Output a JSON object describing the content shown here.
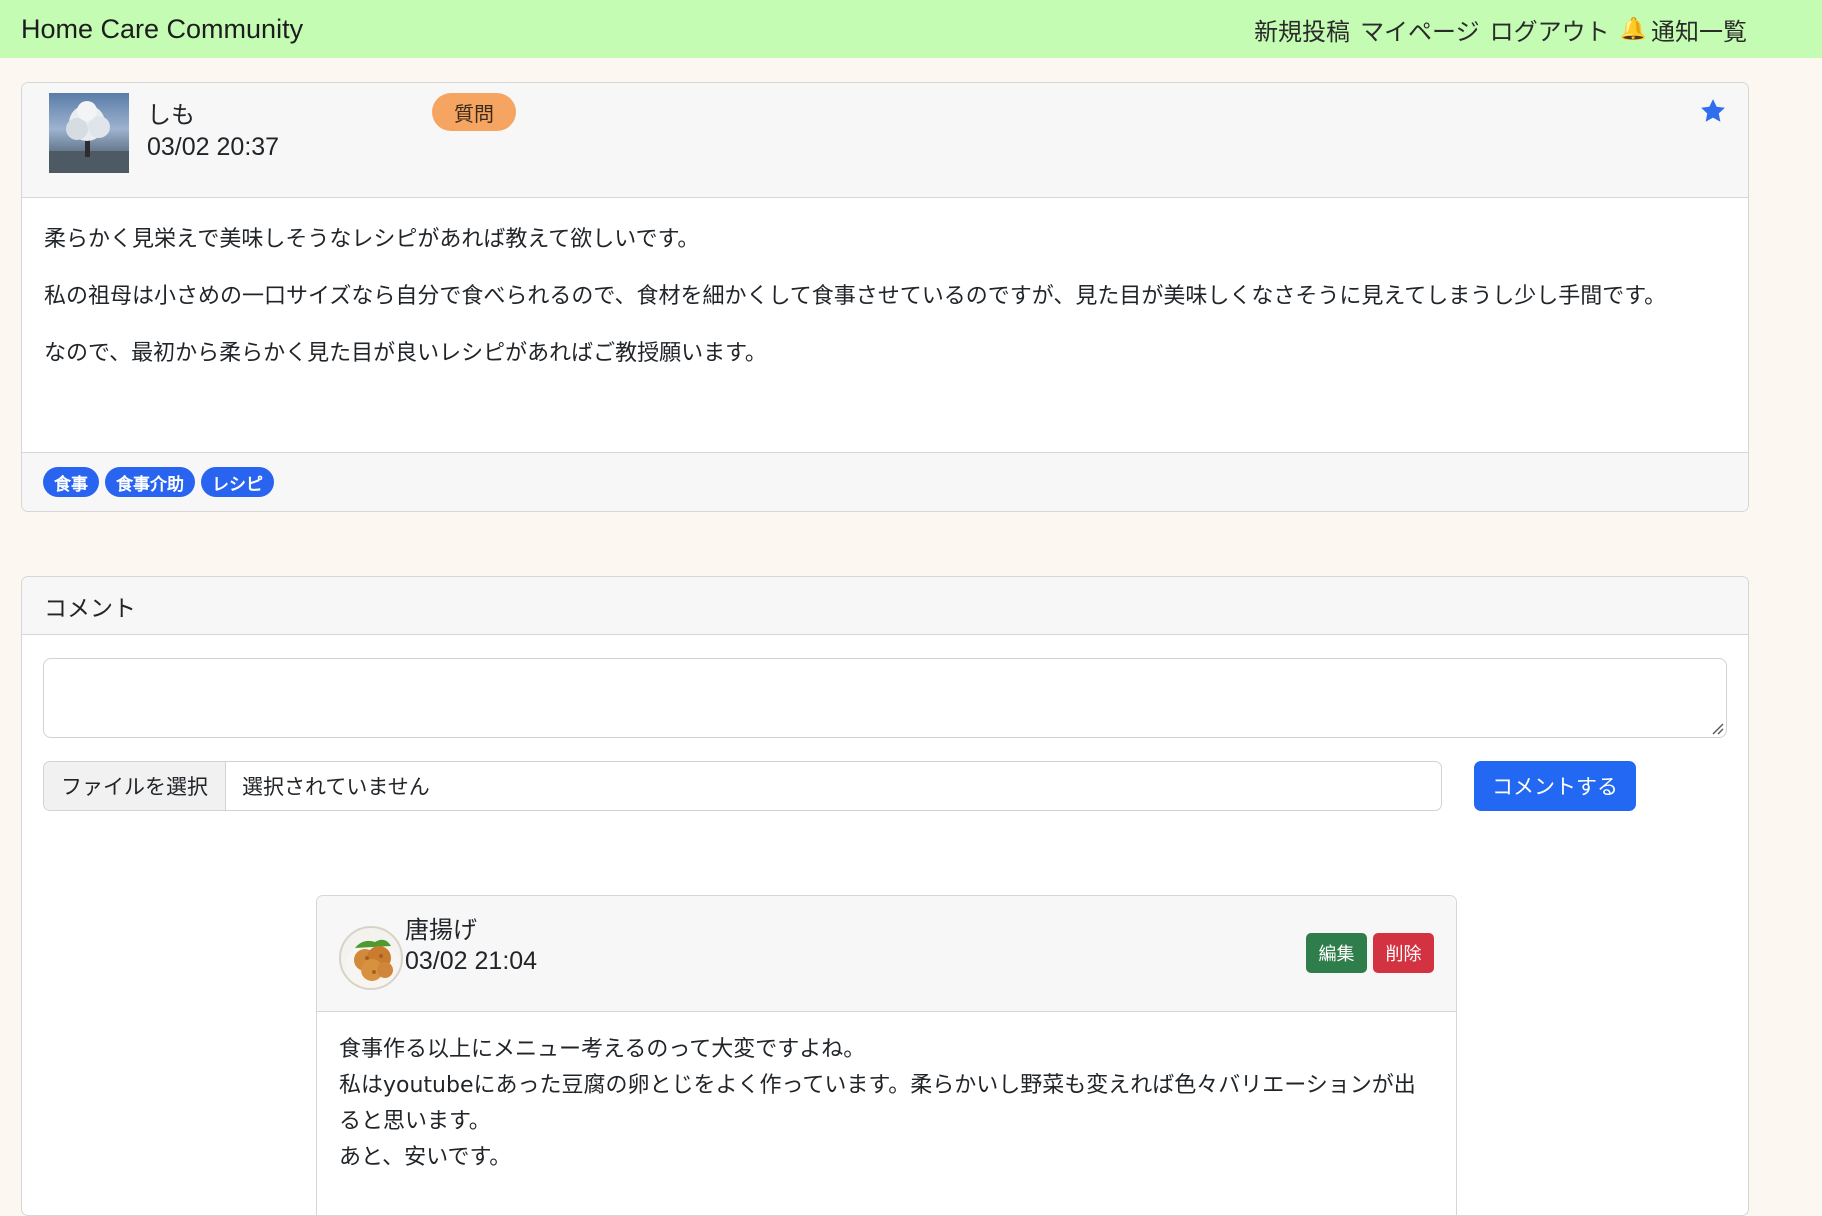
{
  "app": {
    "brand": "Home Care Community"
  },
  "nav": {
    "new_post": "新規投稿",
    "mypage": "マイページ",
    "logout": "ログアウト",
    "notifications": "通知一覧",
    "bell_icon": "bell-icon",
    "bell_color": "#e0301e"
  },
  "post": {
    "user": "しも",
    "date": "03/02 20:37",
    "category": "質問",
    "favorited": true,
    "star_color": "#2f6fef",
    "paragraphs": [
      "柔らかく見栄えで美味しそうなレシピがあれば教えて欲しいです。",
      "私の祖母は小さめの一口サイズなら自分で食べられるので、食材を細かくして食事させているのですが、見た目が美味しくなさそうに見えてしまうし少し手間です。",
      "なので、最初から柔らかく見た目が良いレシピがあればご教授願います。"
    ],
    "tags": [
      "食事",
      "食事介助",
      "レシピ"
    ]
  },
  "comments": {
    "header": "コメント",
    "textarea_value": "",
    "file_button": "ファイルを選択",
    "file_status": "選択されていません",
    "submit": "コメントする",
    "items": [
      {
        "user": "唐揚げ",
        "date": "03/02 21:04",
        "edit": "編集",
        "delete": "削除",
        "lines": [
          "食事作る以上にメニュー考えるのって大変ですよね。",
          "私はyoutubeにあった豆腐の卵とじをよく作っています。柔らかいし野菜も変えれば色々バリエーションが出ると思います。",
          "あと、安いです。"
        ]
      }
    ]
  }
}
